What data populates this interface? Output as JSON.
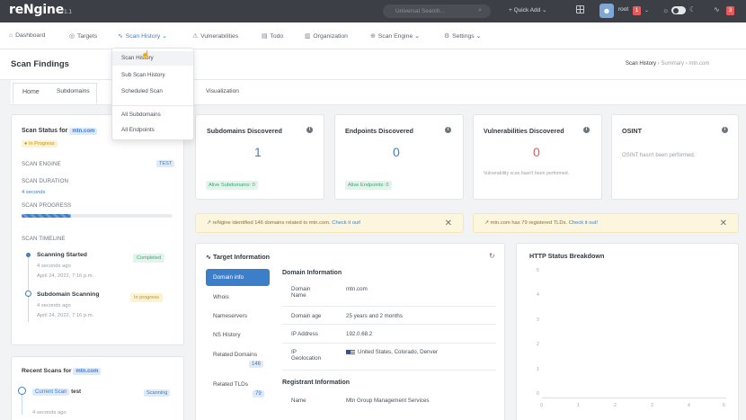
{
  "topbar": {
    "logo": "reNgine",
    "version": "1.1",
    "search_placeholder": "Universal Search...",
    "quick_add": "+ Quick Add ⌄",
    "username": "root",
    "notif_count_1": "1",
    "notif_count_2": "3"
  },
  "nav": {
    "items": [
      {
        "label": "Dashboard",
        "icon": "⌂"
      },
      {
        "label": "Targets",
        "icon": "◎"
      },
      {
        "label": "Scan History ⌄",
        "icon": "∿"
      },
      {
        "label": "Vulnerabilities",
        "icon": "⚠"
      },
      {
        "label": "Todo",
        "icon": "▤"
      },
      {
        "label": "Organization",
        "icon": "▥"
      },
      {
        "label": "Scan Engine ⌄",
        "icon": "⊕"
      },
      {
        "label": "Settings ⌄",
        "icon": "⚙"
      }
    ]
  },
  "dropdown": {
    "items": [
      "Scan History",
      "Sub Scan History",
      "Scheduled Scan",
      "All Subdomains",
      "All Endpoints"
    ]
  },
  "page": {
    "title": "Scan Findings",
    "breadcrumb_1": "Scan History",
    "breadcrumb_2": "Summary",
    "breadcrumb_3": "mtn.com"
  },
  "tabs": {
    "home": "Home",
    "subdomains": "Subdomains",
    "visualization": "Visualization"
  },
  "status": {
    "label": "Scan Status for",
    "domain": "mtn.com",
    "state": "In Progress",
    "engine_label": "SCAN ENGINE",
    "engine_value": "TEST",
    "duration_label": "SCAN DURATION",
    "duration_value": "4 seconds",
    "progress_label": "SCAN PROGRESS",
    "progress": 0.33,
    "timeline_label": "SCAN TIMELINE",
    "timeline": [
      {
        "title": "Scanning Started",
        "status": "Completed",
        "ago": "4 seconds ago",
        "date": "April 24, 2022, 7:16 p.m."
      },
      {
        "title": "Subdomain Scanning",
        "status": "In progress",
        "ago": "4 seconds ago",
        "date": "April 24, 2022, 7:16 p.m."
      }
    ]
  },
  "recent": {
    "title": "Recent Scans for",
    "domain": "mtn.com",
    "current_label": "Current Scan",
    "scan_name": "test",
    "scan_status": "Scanning",
    "ago": "4 seconds ago"
  },
  "stats": {
    "subdomains": {
      "title": "Subdomains Discovered",
      "value": "1",
      "sub": "Alive Subdomains: 0"
    },
    "endpoints": {
      "title": "Endpoints Discovered",
      "value": "0",
      "sub": "Alive Endpoints: 0"
    },
    "vulns": {
      "title": "Vulnerabilities Discovered",
      "value": "0",
      "sub": "Vulnerability scan hasn't been performed."
    },
    "osint": {
      "title": "OSINT",
      "sub": "OSINT hasn't been performed."
    }
  },
  "alerts": {
    "a1_text": "reNgine identified 146 domains related to mtn.com.",
    "a1_link": "Check it out!",
    "a2_text": "mtn.com has 79 registered TLDs.",
    "a2_link": "Check it out!"
  },
  "target": {
    "title": "Target Information",
    "left_items": [
      "Domain info",
      "Whois",
      "Nameservers",
      "NS History",
      "Related Domains",
      "Related TLDs"
    ],
    "related_domains_count": "146",
    "related_tlds_count": "79",
    "domain_info_title": "Domain Information",
    "rows": [
      {
        "k1": "Domain",
        "k2": "Name",
        "v": "mtn.com"
      },
      {
        "k1": "Domain age",
        "k2": "",
        "v": "25 years and 2 months"
      },
      {
        "k1": "IP Address",
        "k2": "",
        "v": "192.0.68.2"
      },
      {
        "k1": "IP",
        "k2": "Geolocation",
        "v": "United States, Colorado, Denver"
      }
    ],
    "registrant_title": "Registrant Information",
    "registrant_name_label": "Name",
    "registrant_name": "Mtn Group Management Services"
  },
  "http": {
    "title": "HTTP Status Breakdown",
    "y_ticks": [
      "5",
      "4",
      "3",
      "2",
      "1",
      "0"
    ],
    "x_ticks": [
      "0",
      "1",
      "2",
      "3",
      "4",
      "5"
    ]
  },
  "colors": {
    "topbar": "#3c3f45",
    "accent": "#3d7ec9",
    "success": "#39a86f",
    "warning": "#f2c94c",
    "danger": "#e85a5a"
  }
}
